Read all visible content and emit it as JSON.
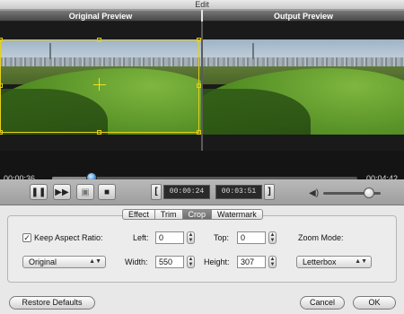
{
  "window": {
    "title": "Edit"
  },
  "preview": {
    "original_label": "Original Preview",
    "output_label": "Output Preview"
  },
  "timeline": {
    "current_time": "00:00:36",
    "duration": "00:04:42",
    "progress": 0.13
  },
  "playback": {
    "play_pause_icon": "pause-icon",
    "forward_icon": "fast-forward-icon",
    "frame_icon": "frame-step-icon",
    "stop_icon": "stop-icon",
    "start_bracket": "[",
    "end_bracket": "]",
    "trim_start": "00:00:24",
    "trim_end": "00:03:51",
    "volume_level": 0.8
  },
  "tabs": [
    {
      "label": "Effect",
      "active": false
    },
    {
      "label": "Trim",
      "active": false
    },
    {
      "label": "Crop",
      "active": true
    },
    {
      "label": "Watermark",
      "active": false
    }
  ],
  "crop": {
    "keep_aspect_label": "Keep Aspect Ratio:",
    "keep_aspect_checked": true,
    "check_mark": "✓",
    "left_label": "Left:",
    "left_value": "0",
    "top_label": "Top:",
    "top_value": "0",
    "zoom_label": "Zoom Mode:",
    "aspect_select": "Original",
    "width_label": "Width:",
    "width_value": "550",
    "height_label": "Height:",
    "height_value": "307",
    "zoom_select": "Letterbox"
  },
  "footer": {
    "restore_label": "Restore Defaults",
    "cancel_label": "Cancel",
    "ok_label": "OK"
  },
  "colors": {
    "crop_frame": "#e6d11a",
    "accent_knob": "#4a8fd0"
  }
}
